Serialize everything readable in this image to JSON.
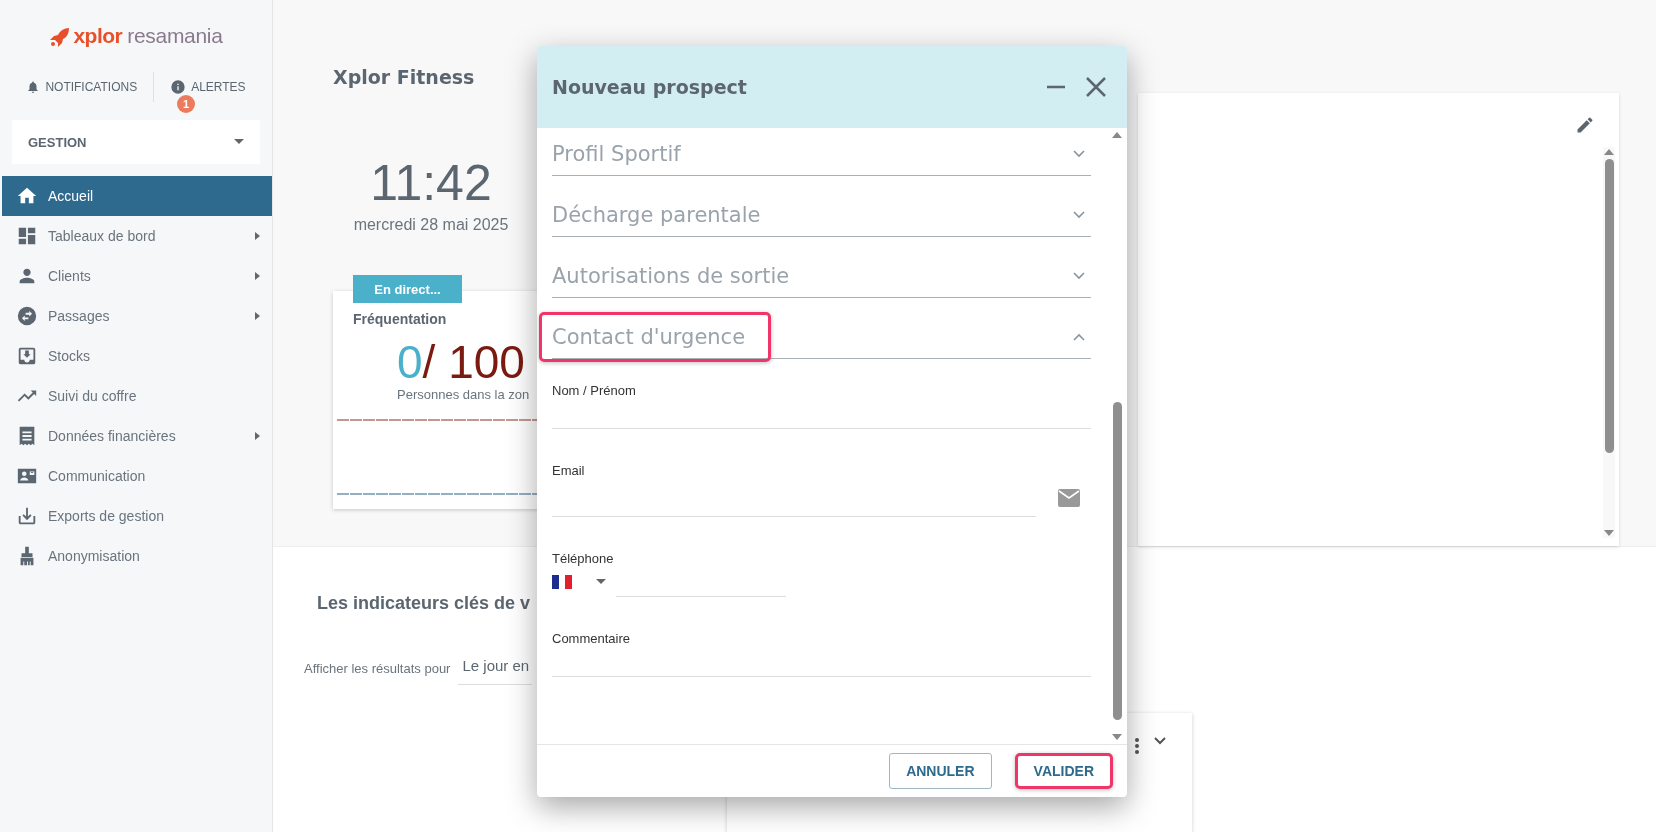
{
  "logo": {
    "brand": "xplor",
    "product": "resamania"
  },
  "header_links": [
    {
      "label": "NOTIFICATIONS"
    },
    {
      "label": "ALERTES",
      "badge": "1"
    }
  ],
  "module_select": {
    "value": "GESTION"
  },
  "sidebar": {
    "items": [
      {
        "label": "Accueil",
        "selected": true,
        "has_submenu": false
      },
      {
        "label": "Tableaux de bord",
        "selected": false,
        "has_submenu": true
      },
      {
        "label": "Clients",
        "selected": false,
        "has_submenu": true
      },
      {
        "label": "Passages",
        "selected": false,
        "has_submenu": true
      },
      {
        "label": "Stocks",
        "selected": false,
        "has_submenu": false
      },
      {
        "label": "Suivi du coffre",
        "selected": false,
        "has_submenu": false
      },
      {
        "label": "Données financières",
        "selected": false,
        "has_submenu": true
      },
      {
        "label": "Communication",
        "selected": false,
        "has_submenu": false
      },
      {
        "label": "Exports de gestion",
        "selected": false,
        "has_submenu": false
      },
      {
        "label": "Anonymisation",
        "selected": false,
        "has_submenu": false
      }
    ]
  },
  "main": {
    "title": "Xplor Fitness",
    "clock": {
      "time": "11:42",
      "date": "mercredi 28 mai 2025"
    },
    "attendance_card": {
      "tag": "En direct...",
      "title": "Fréquentation",
      "current": "0",
      "capacity": "/ 100",
      "caption": "Personnes dans la zon"
    },
    "kpi_section": {
      "title": "Les indicateurs clés de v",
      "filter_label": "Afficher les résultats pour",
      "filter_value": "Le jour en"
    }
  },
  "dialog": {
    "title": "Nouveau prospect",
    "sections": [
      {
        "title": "Profil Sportif",
        "expanded": false,
        "highlighted": false
      },
      {
        "title": "Décharge parentale",
        "expanded": false,
        "highlighted": false
      },
      {
        "title": "Autorisations de sortie",
        "expanded": false,
        "highlighted": false
      },
      {
        "title": "Contact d'urgence",
        "expanded": true,
        "highlighted": true,
        "fields": [
          {
            "kind": "text",
            "label": "Nom / Prénom"
          },
          {
            "kind": "email",
            "label": "Email"
          },
          {
            "kind": "phone",
            "label": "Téléphone"
          },
          {
            "kind": "text",
            "label": "Commentaire"
          }
        ]
      }
    ],
    "buttons": [
      {
        "label": "ANNULER",
        "kind": "outlined",
        "highlighted": false
      },
      {
        "label": "VALIDER",
        "kind": "flat",
        "highlighted": true
      }
    ]
  }
}
